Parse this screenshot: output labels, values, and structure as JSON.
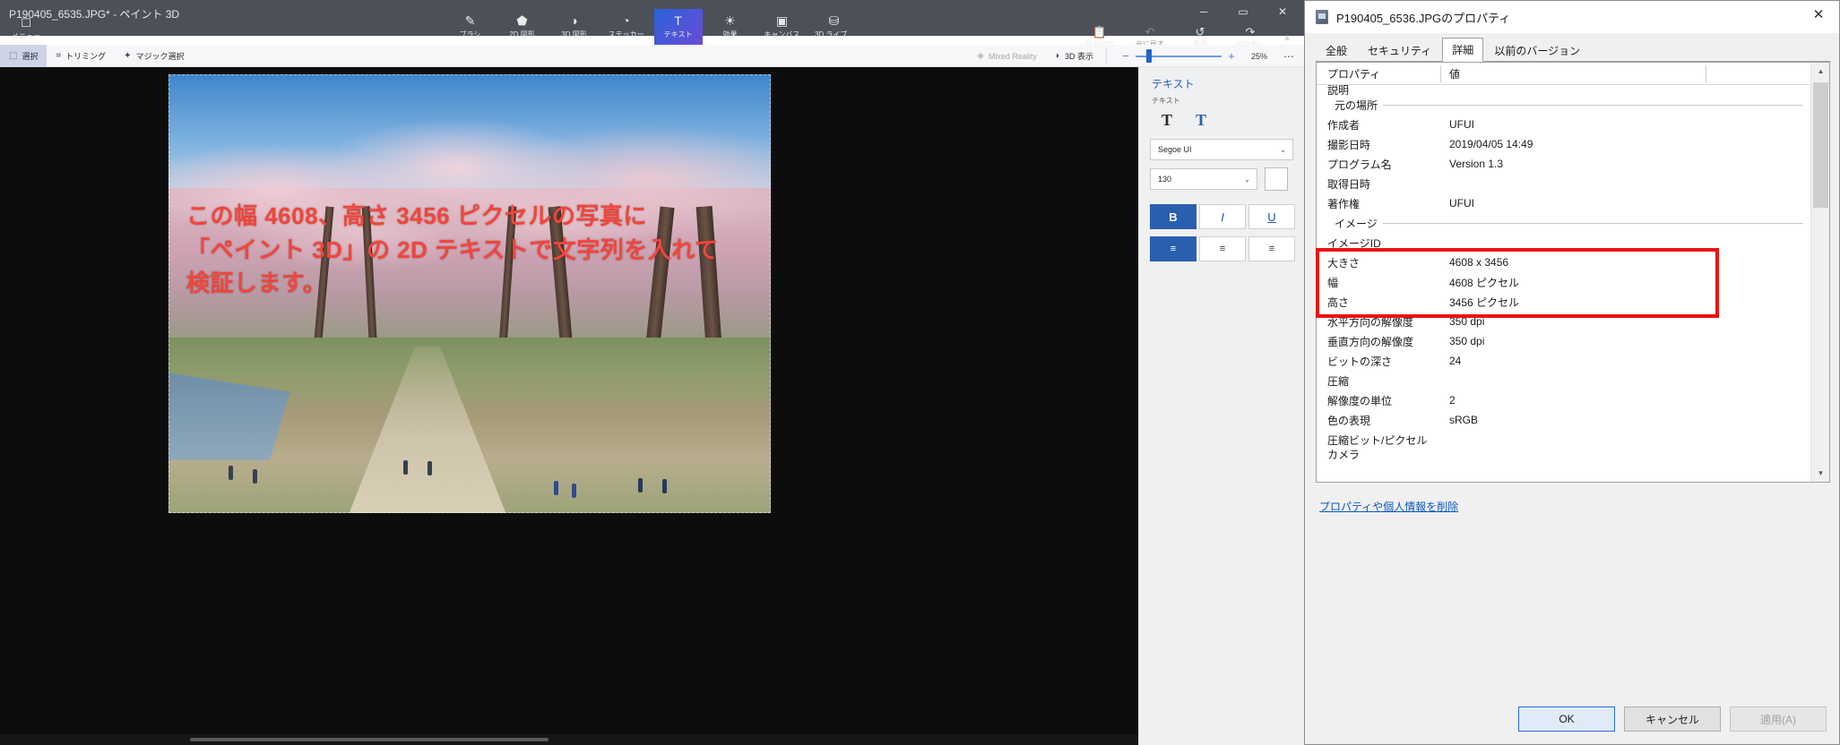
{
  "paint3d": {
    "title": "P190405_6535.JPG* - ペイント 3D",
    "menu": {
      "label": "メニュー",
      "icon": "menu-square-icon"
    },
    "window_controls": {
      "minimize": "─",
      "maximize": "▭",
      "close": "✕"
    },
    "ribbon_tools": [
      {
        "label": "ブラシ",
        "icon": "brush-icon",
        "glyph": "✎",
        "active": false
      },
      {
        "label": "2D 図形",
        "icon": "shapes-2d-icon",
        "glyph": "⬟",
        "active": false
      },
      {
        "label": "3D 図形",
        "icon": "shapes-3d-icon",
        "glyph": "◑",
        "active": false
      },
      {
        "label": "ステッカー",
        "icon": "sticker-icon",
        "glyph": "◔",
        "active": false
      },
      {
        "label": "テキスト",
        "icon": "text-icon",
        "glyph": "T",
        "active": true
      },
      {
        "label": "効果",
        "icon": "effects-icon",
        "glyph": "☀",
        "active": false
      },
      {
        "label": "キャンバス",
        "icon": "canvas-icon",
        "glyph": "▣",
        "active": false
      },
      {
        "label": "3D ライブ...",
        "icon": "3d-library-icon",
        "glyph": "⛁",
        "active": false
      }
    ],
    "ribbon_right": [
      {
        "label": "貼り付け",
        "icon": "paste-icon",
        "glyph": "📋",
        "disabled": false
      },
      {
        "label": "元に戻す",
        "icon": "undo-icon",
        "glyph": "↶",
        "disabled": true
      },
      {
        "label": "履歴",
        "icon": "history-icon",
        "glyph": "↺",
        "disabled": false
      },
      {
        "label": "やり直し",
        "icon": "redo-icon",
        "glyph": "↷",
        "disabled": false
      }
    ],
    "ribbon_collapse_icon": "chevron-up-icon",
    "subbar_left": [
      {
        "label": "選択",
        "icon": "select-icon",
        "glyph": "⬚",
        "active": true
      },
      {
        "label": "トリミング",
        "icon": "crop-icon",
        "glyph": "⌗",
        "active": false
      },
      {
        "label": "マジック選択",
        "icon": "magic-select-icon",
        "glyph": "✦",
        "active": false
      }
    ],
    "subbar_right": [
      {
        "label": "Mixed Reality",
        "icon": "mixed-reality-icon",
        "glyph": "◈",
        "disabled": true
      },
      {
        "label": "3D 表示",
        "icon": "view-3d-icon",
        "glyph": "◗",
        "disabled": false
      }
    ],
    "zoom": {
      "minus_icon": "minus-icon",
      "plus_icon": "plus-icon",
      "value": "25%",
      "more_icon": "ellipsis-icon",
      "more_label": "⋯"
    },
    "canvas": {
      "overlay_text": "この幅 4608、高さ 3456 ピクセルの写真に\n「ペイント 3D」の 2D テキストで文字列を入れて\n検証します。",
      "overlay_color": "#f2453b"
    },
    "text_panel": {
      "heading": "テキスト",
      "sub_label": "テキスト",
      "modes": [
        {
          "label": "T",
          "icon": "text-2d-icon",
          "active": false
        },
        {
          "label": "T",
          "icon": "text-3d-icon",
          "active": true
        }
      ],
      "font": {
        "value": "Segoe UI",
        "chevron": "⌄"
      },
      "size": {
        "value": "130",
        "chevron": "⌄"
      },
      "color_swatch": "#ffffff",
      "style_buttons": [
        {
          "label": "B",
          "icon": "bold-icon",
          "on": true
        },
        {
          "label": "I",
          "icon": "italic-icon",
          "on": false
        },
        {
          "label": "U",
          "icon": "underline-icon",
          "on": false
        }
      ],
      "align_buttons": [
        {
          "label": "≡",
          "icon": "align-left-icon",
          "on": true
        },
        {
          "label": "≡",
          "icon": "align-center-icon",
          "on": false
        },
        {
          "label": "≡",
          "icon": "align-right-icon",
          "on": false
        }
      ]
    }
  },
  "dialog": {
    "title": "P190405_6536.JPGのプロパティ",
    "icon": "file-image-icon",
    "close_icon": "close-icon",
    "close_glyph": "✕",
    "tabs": [
      {
        "label": "全般",
        "active": false
      },
      {
        "label": "セキュリティ",
        "active": false
      },
      {
        "label": "詳細",
        "active": true
      },
      {
        "label": "以前のバージョン",
        "active": false
      }
    ],
    "columns": {
      "property": "プロパティ",
      "value": "値"
    },
    "rows": [
      {
        "type": "partial",
        "key": "説明",
        "value": ""
      },
      {
        "type": "group",
        "key": "元の場所",
        "value": ""
      },
      {
        "type": "item",
        "key": "作成者",
        "value": "UFUI"
      },
      {
        "type": "item",
        "key": "撮影日時",
        "value": "2019/04/05 14:49"
      },
      {
        "type": "item",
        "key": "プログラム名",
        "value": "Version 1.3"
      },
      {
        "type": "item",
        "key": "取得日時",
        "value": ""
      },
      {
        "type": "item",
        "key": "著作権",
        "value": "UFUI"
      },
      {
        "type": "group",
        "key": "イメージ",
        "value": ""
      },
      {
        "type": "item",
        "key": "イメージID",
        "value": ""
      },
      {
        "type": "item",
        "key": "大きさ",
        "value": "4608 x 3456",
        "highlight": true
      },
      {
        "type": "item",
        "key": "幅",
        "value": "4608 ピクセル",
        "highlight": true
      },
      {
        "type": "item",
        "key": "高さ",
        "value": "3456 ピクセル",
        "highlight": true
      },
      {
        "type": "item",
        "key": "水平方向の解像度",
        "value": "350 dpi"
      },
      {
        "type": "item",
        "key": "垂直方向の解像度",
        "value": "350 dpi"
      },
      {
        "type": "item",
        "key": "ビットの深さ",
        "value": "24"
      },
      {
        "type": "item",
        "key": "圧縮",
        "value": ""
      },
      {
        "type": "item",
        "key": "解像度の単位",
        "value": "2"
      },
      {
        "type": "item",
        "key": "色の表現",
        "value": "sRGB"
      },
      {
        "type": "item",
        "key": "圧縮ビット/ピクセル",
        "value": ""
      },
      {
        "type": "partial",
        "key": "カメラ",
        "value": ""
      }
    ],
    "scrollbar": {
      "up_icon": "scroll-up-icon",
      "down_icon": "scroll-down-icon",
      "up_glyph": "▲",
      "down_glyph": "▼"
    },
    "link": "プロパティや個人情報を削除",
    "buttons": [
      {
        "label": "OK",
        "style": "primary"
      },
      {
        "label": "キャンセル",
        "style": "normal"
      },
      {
        "label": "適用(A)",
        "style": "disabled"
      }
    ],
    "highlight_color": "#ee1111"
  }
}
